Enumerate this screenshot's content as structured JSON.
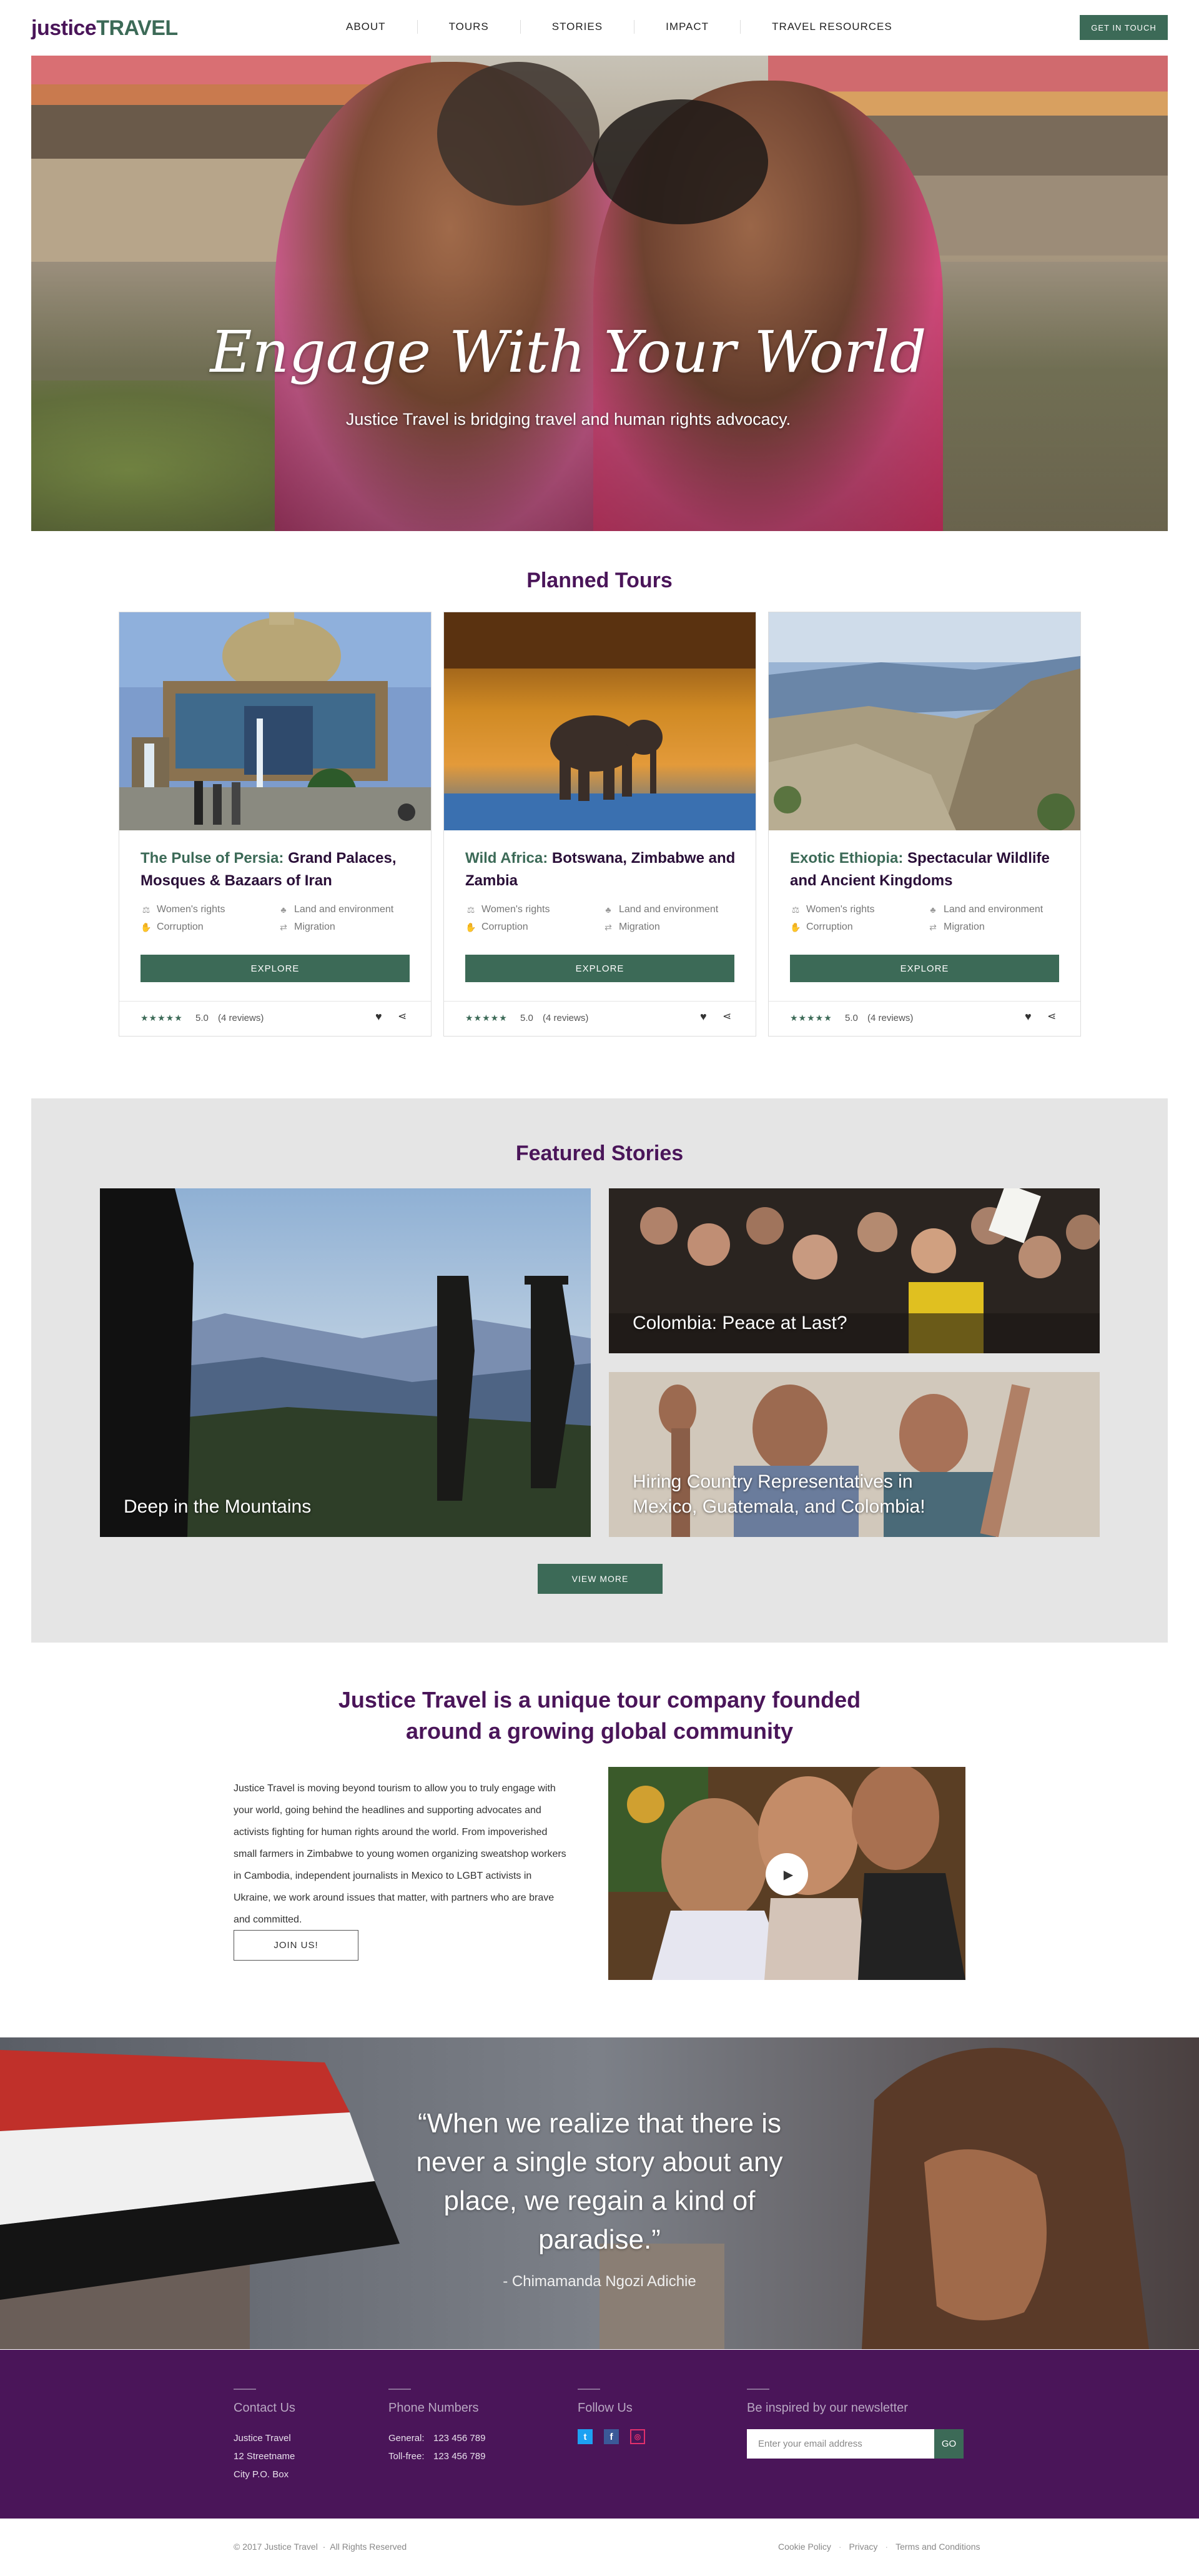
{
  "header": {
    "logo_part1": "justice",
    "logo_part2": "TRAVEL",
    "nav": [
      "ABOUT",
      "TOURS",
      "STORIES",
      "IMPACT",
      "TRAVEL RESOURCES"
    ],
    "cta": "GET IN TOUCH"
  },
  "hero": {
    "title": "Engage With Your World",
    "subtitle": "Justice Travel is bridging travel and human rights advocacy."
  },
  "tours": {
    "title": "Planned Tours",
    "cards": [
      {
        "title_highlight": "The Pulse of Persia:",
        "title_rest": " Grand Palaces, Mosques & Bazaars of Iran",
        "tags": [
          "Women's rights",
          "Land and environment",
          "Corruption",
          "Migration"
        ],
        "button": "EXPLORE",
        "rating": "5.0",
        "reviews": "(4 reviews)"
      },
      {
        "title_highlight": "Wild Africa:",
        "title_rest": " Botswana, Zimbabwe and Zambia",
        "tags": [
          "Women's rights",
          "Land and environment",
          "Corruption",
          "Migration"
        ],
        "button": "EXPLORE",
        "rating": "5.0",
        "reviews": "(4 reviews)"
      },
      {
        "title_highlight": "Exotic Ethiopia:",
        "title_rest": " Spectacular Wildlife and Ancient Kingdoms",
        "tags": [
          "Women's rights",
          "Land and environment",
          "Corruption",
          "Migration"
        ],
        "button": "EXPLORE",
        "rating": "5.0",
        "reviews": "(4 reviews)"
      }
    ]
  },
  "featured": {
    "title": "Featured Stories",
    "stories": [
      "Deep in the Mountains",
      "Colombia: Peace at Last?",
      "Hiring Country Representatives in Mexico, Guatemala, and Colombia!"
    ],
    "button": "VIEW MORE"
  },
  "about": {
    "title_line1": "Justice Travel is a unique tour company founded",
    "title_line2": "around a growing global community",
    "body": "Justice Travel is moving beyond tourism to allow you to truly engage with your world, going behind the headlines and supporting advocates and activists fighting for human rights around the world. From impoverished small farmers in Zimbabwe to young women organizing sweatshop workers in Cambodia, independent journalists in Mexico to LGBT activists in Ukraine, we work around issues that matter, with partners who are brave and committed.",
    "button": "JOIN US!"
  },
  "quote": {
    "text": "“When we realize that there is never a single story about any place, we regain a kind of paradise.”",
    "author": "- Chimamanda Ngozi Adichie"
  },
  "footer": {
    "contact": {
      "heading": "Contact Us",
      "lines": [
        "Justice Travel",
        "12 Streetname",
        "City P.O. Box"
      ]
    },
    "phones": {
      "heading": "Phone Numbers",
      "general_label": "General:",
      "general": "123 456 789",
      "tollfree_label": "Toll-free:",
      "tollfree": "123 456 789"
    },
    "follow": {
      "heading": "Follow Us"
    },
    "newsletter": {
      "heading": "Be inspired by our newsletter",
      "placeholder": "Enter your email address",
      "button": "GO"
    },
    "copyright": "© 2017 Justice Travel",
    "rights": "All Rights Reserved",
    "legal": [
      "Cookie Policy",
      "Privacy",
      "Terms and Conditions"
    ]
  },
  "colors": {
    "brand_purple": "#4a1559",
    "brand_green": "#3c6a57",
    "featured_bg": "#e5e5e5"
  }
}
